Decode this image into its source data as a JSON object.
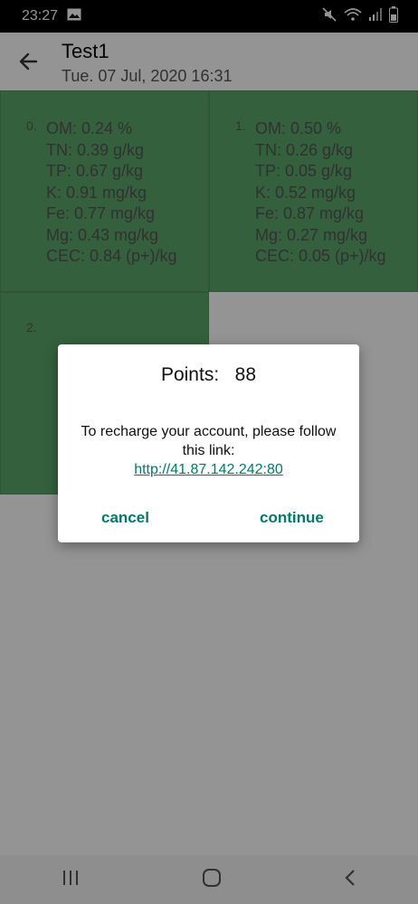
{
  "status_bar": {
    "time": "23:27"
  },
  "header": {
    "title": "Test1",
    "subtitle": "Tue. 07 Jul, 2020 16:31"
  },
  "cells": [
    {
      "index": "0.",
      "lines": [
        "OM: 0.24 %",
        "TN: 0.39 g/kg",
        "TP: 0.67 g/kg",
        "K: 0.91 mg/kg",
        "Fe: 0.77 mg/kg",
        "Mg: 0.43 mg/kg",
        "CEC: 0.84 (p+)/kg"
      ]
    },
    {
      "index": "1.",
      "lines": [
        "OM: 0.50 %",
        "TN: 0.26 g/kg",
        "TP: 0.05 g/kg",
        "K: 0.52 mg/kg",
        "Fe: 0.87 mg/kg",
        "Mg: 0.27 mg/kg",
        "CEC: 0.05 (p+)/kg"
      ]
    },
    {
      "index": "2."
    }
  ],
  "dialog": {
    "points_label": "Points:",
    "points_value": "88",
    "message": "To recharge your account, please follow this link:",
    "link": "http://41.87.142.242:80",
    "cancel_label": "cancel",
    "continue_label": "continue"
  },
  "colors": {
    "cell_green": "#5aa56a",
    "accent": "#00796b"
  }
}
